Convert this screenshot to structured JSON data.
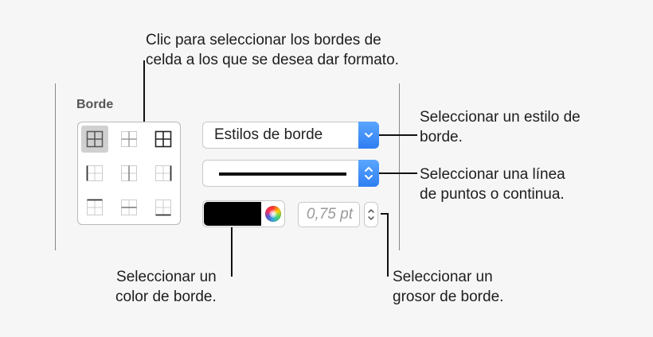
{
  "panel": {
    "section_title": "Borde",
    "border_styles_label": "Estilos de borde",
    "thickness_value": "0,75 pt",
    "selected_color": "#000000",
    "accent_color": "#3a8cf6"
  },
  "border_grid": {
    "selected_index": 0,
    "cells": [
      {
        "icon": "all-borders-icon"
      },
      {
        "icon": "inside-borders-icon"
      },
      {
        "icon": "outside-borders-icon"
      },
      {
        "icon": "left-border-icon"
      },
      {
        "icon": "inside-vertical-border-icon"
      },
      {
        "icon": "right-border-icon"
      },
      {
        "icon": "top-border-icon"
      },
      {
        "icon": "inside-horizontal-border-icon"
      },
      {
        "icon": "bottom-border-icon"
      }
    ]
  },
  "callouts": {
    "grid": [
      "Clic para seleccionar los bordes de",
      "celda a los que se desea dar formato."
    ],
    "style": [
      "Seleccionar un estilo de",
      "borde."
    ],
    "line": [
      "Seleccionar una línea",
      "de puntos o continua."
    ],
    "color": [
      "Seleccionar un",
      "color de borde."
    ],
    "thickness": [
      "Seleccionar un",
      "grosor de borde."
    ]
  }
}
